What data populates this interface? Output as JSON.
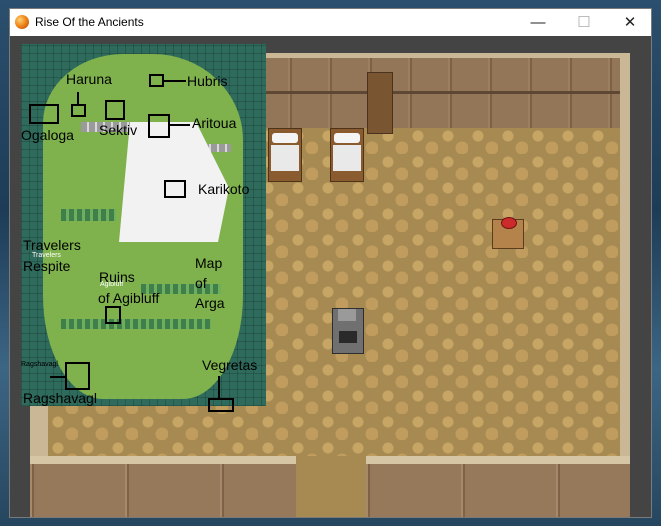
{
  "window": {
    "title": "Rise Of the Ancients",
    "minimize_glyph": "—",
    "maximize_glyph": "☐",
    "close_glyph": "✕"
  },
  "map_overlay": {
    "labels": {
      "haruna": "Haruna",
      "hubris": "Hubris",
      "ogaloga": "Ogaloga",
      "sektiv": "Sektiv",
      "aritoua": "Aritoua",
      "karikoto": "Karikoto",
      "travelers": "Travelers",
      "respite": "Respite",
      "travelers_small": "Travelers",
      "ruins_line1": "Ruins",
      "ruins_line2": "of Agibluff",
      "agibluff_small": "Agibluff",
      "map_line1": "Map",
      "map_line2": "of",
      "map_line3": "Arga",
      "ragshavagl": "Ragshavagl",
      "ragshavagl_small": "Ragshavagl",
      "vegretas": "Vegretas"
    }
  }
}
